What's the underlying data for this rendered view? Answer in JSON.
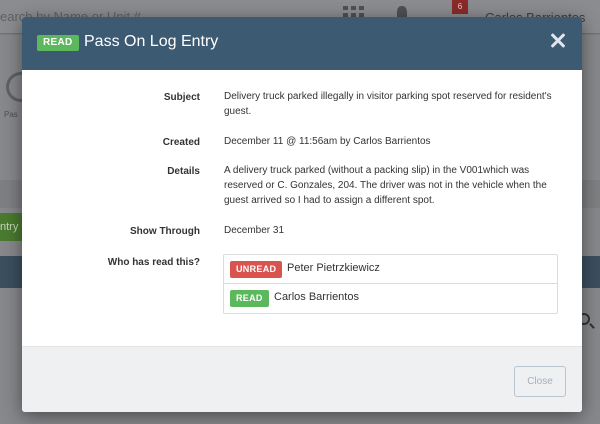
{
  "background": {
    "search_placeholder": "earch by Name or Unit #",
    "notification_count": "6",
    "user_name": "Carlos Barrientos",
    "side_text": "Pas",
    "entry_button": "ntry"
  },
  "modal": {
    "header_badge": "READ",
    "title": "Pass On Log Entry",
    "fields": {
      "subject_label": "Subject",
      "subject_value": "Delivery truck parked illegally in visitor parking spot reserved for resident's guest.",
      "created_label": "Created",
      "created_value": "December 11 @ 11:56am by Carlos Barrientos",
      "details_label": "Details",
      "details_value": "A delivery truck parked (without a packing slip) in the V001which was reserved or C. Gonzales, 204. The driver was not in the vehicle when the guest arrived so I had to assign a different spot.",
      "show_through_label": "Show Through",
      "show_through_value": "December 31",
      "who_read_label": "Who has read this?"
    },
    "readers": [
      {
        "status": "UNREAD",
        "name": "Peter Pietrzkiewicz",
        "color": "#d9534f"
      },
      {
        "status": "READ",
        "name": "Carlos Barrientos",
        "color": "#5cb85c"
      }
    ],
    "close_button": "Close"
  },
  "colors": {
    "header_bg": "#3d5a73",
    "read_green": "#5cb85c",
    "unread_red": "#d9534f",
    "footer_bg": "#eef0f2"
  }
}
